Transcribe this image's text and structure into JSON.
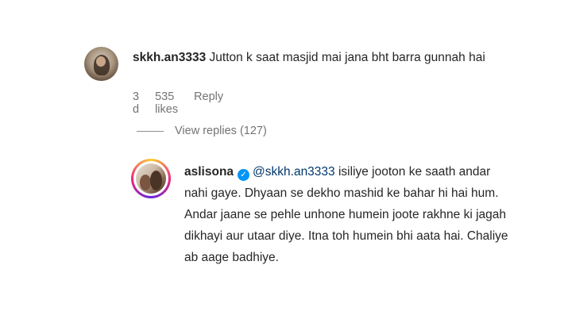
{
  "comments": [
    {
      "username": "skkh.an3333",
      "text": "Jutton k saat masjid mai jana bht barra gunnah hai",
      "time": "3 d",
      "likes": "535 likes",
      "reply_label": "Reply",
      "view_replies": "View replies (127)"
    },
    {
      "username": "aslisona",
      "verified": true,
      "mention": "@skkh.an3333",
      "text": "isiliye jooton ke saath andar nahi gaye. Dhyaan se dekho mashid ke bahar hi hai hum. Andar jaane se pehle unhone humein joote rakhne ki jagah dikhayi aur utaar diye. Itna toh humein bhi aata hai. Chaliye ab aage badhiye."
    }
  ],
  "colors": {
    "text": "#262626",
    "meta": "#737373",
    "verified": "#0095f6",
    "mention": "#00376b"
  }
}
